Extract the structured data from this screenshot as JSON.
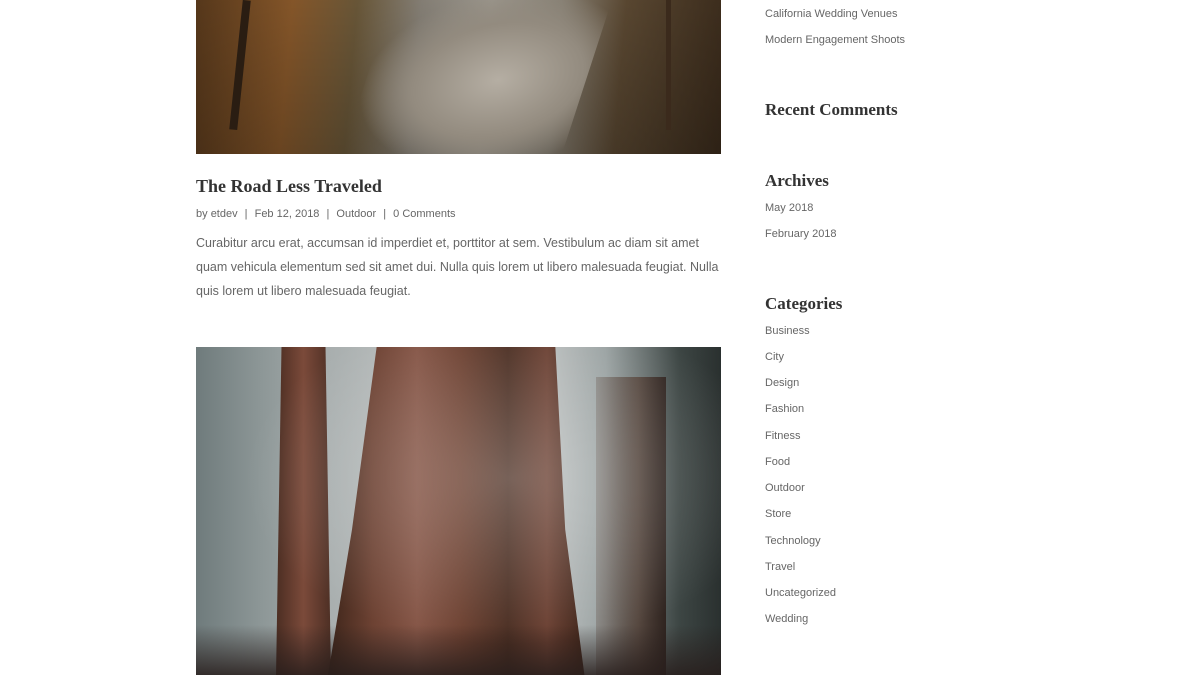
{
  "post": {
    "title": "The Road Less Traveled",
    "meta": {
      "by": "by",
      "author": "etdev",
      "date": "Feb 12, 2018",
      "category": "Outdoor",
      "comments": "0 Comments",
      "separator": "|"
    },
    "excerpt": "Curabitur arcu erat, accumsan id imperdiet et, porttitor at sem. Vestibulum ac diam sit amet quam vehicula elementum sed sit amet dui. Nulla quis lorem ut libero malesuada feugiat. Nulla quis lorem ut libero malesuada feugiat."
  },
  "sidebar": {
    "recent_posts": [
      "California Wedding Venues",
      "Modern Engagement Shoots"
    ],
    "recent_comments_title": "Recent Comments",
    "archives_title": "Archives",
    "archives": [
      "May 2018",
      "February 2018"
    ],
    "categories_title": "Categories",
    "categories": [
      "Business",
      "City",
      "Design",
      "Fashion",
      "Fitness",
      "Food",
      "Outdoor",
      "Store",
      "Technology",
      "Travel",
      "Uncategorized",
      "Wedding"
    ]
  }
}
